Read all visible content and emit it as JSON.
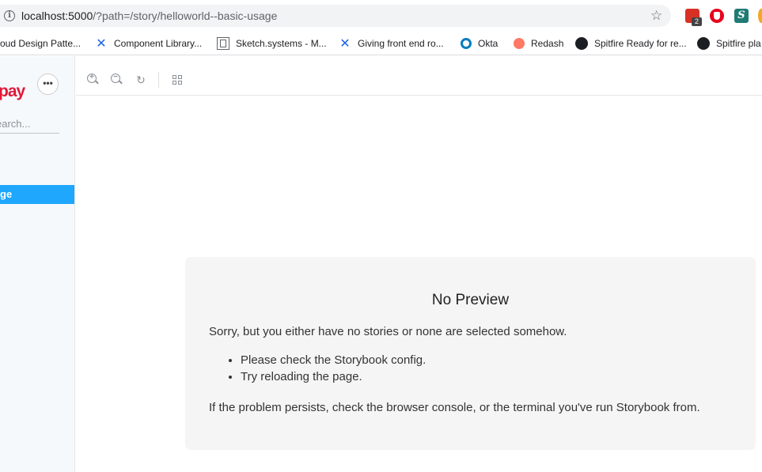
{
  "browser": {
    "url_host": "localhost:5000",
    "url_rest": "/?path=/story/helloworld--basic-usage",
    "extension_badge": "2"
  },
  "bookmarks": [
    {
      "label": "oud Design Patte...",
      "icon": "none"
    },
    {
      "label": "Component Library...",
      "icon": "confluence-icon"
    },
    {
      "label": "Sketch.systems - M...",
      "icon": "sketch-icon"
    },
    {
      "label": "Giving front end ro...",
      "icon": "confluence-icon"
    },
    {
      "label": "Okta",
      "icon": "okta-icon"
    },
    {
      "label": "Redash",
      "icon": "redash-icon"
    },
    {
      "label": "Spitfire Ready for re...",
      "icon": "github-icon"
    },
    {
      "label": "Spitfire pla",
      "icon": "github-icon"
    }
  ],
  "sidebar": {
    "brand": "pay",
    "more_label": "•••",
    "search_placeholder": "earch...",
    "selected_item": "ge"
  },
  "preview": {
    "title": "No Preview",
    "message": "Sorry, but you either have no stories or none are selected somehow.",
    "items": [
      "Please check the Storybook config.",
      "Try reloading the page."
    ],
    "footer": "If the problem persists, check the browser console, or the terminal you've run Storybook from."
  },
  "colors": {
    "accent": "#1ea7fd",
    "brand": "#e31837",
    "card_bg": "#f5f5f5"
  }
}
